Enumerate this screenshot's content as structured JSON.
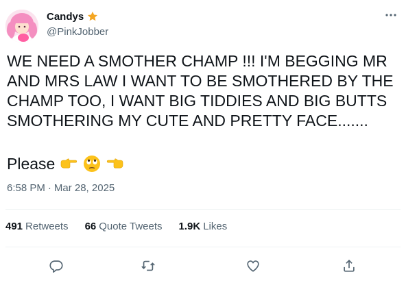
{
  "author": {
    "display_name": "Candys",
    "badge_icon": "star-icon",
    "handle": "@PinkJobber"
  },
  "tweet": {
    "text": "WE NEED A SMOTHER CHAMP !!! I'M BEGGING MR AND MRS LAW I WANT TO BE SMOTHERED BY THE CHAMP TOO, I WANT BIG TIDDIES AND BIG BUTTS SMOTHERING MY CUTE AND PRETTY FACE.......",
    "closing_word": "Please",
    "emojis": [
      "pointing-right-emoji",
      "rolling-eyes-emoji",
      "pointing-left-emoji"
    ]
  },
  "meta": {
    "time": "6:58 PM",
    "separator": "·",
    "date": "Mar 28, 2025"
  },
  "stats": {
    "retweets_count": "491",
    "retweets_label": "Retweets",
    "quotes_count": "66",
    "quotes_label": "Quote Tweets",
    "likes_count": "1.9K",
    "likes_label": "Likes"
  },
  "actions": [
    "reply-icon",
    "retweet-icon",
    "like-icon",
    "share-icon"
  ],
  "colors": {
    "text_primary": "#0f1419",
    "text_secondary": "#536471",
    "divider": "#eff3f4",
    "star": "#f4a623",
    "emoji_yellow": "#fcc21b"
  }
}
